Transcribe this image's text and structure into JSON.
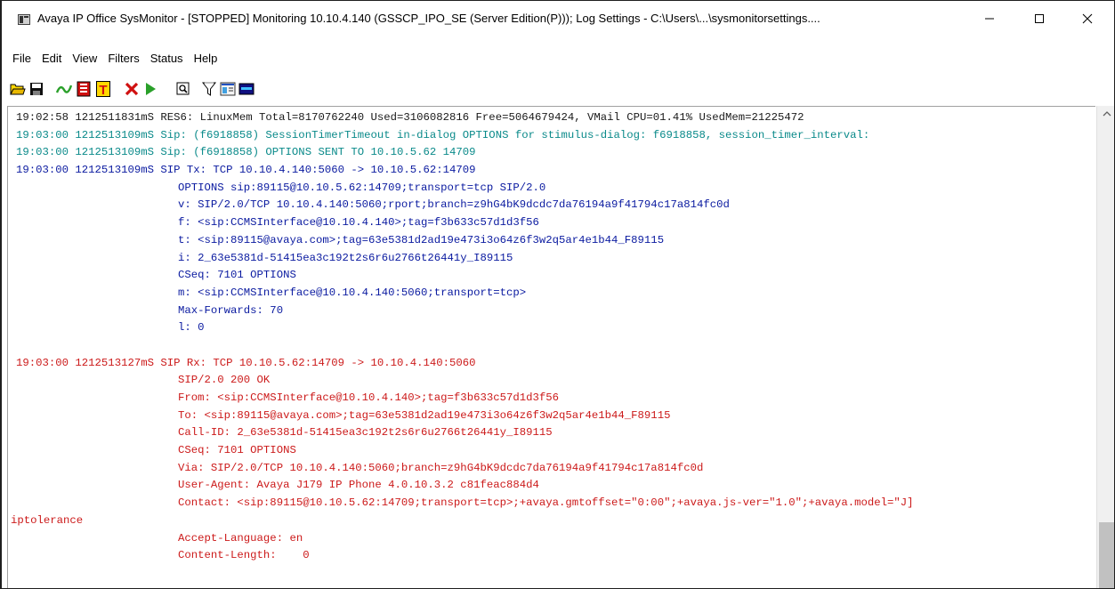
{
  "window": {
    "title": "Avaya IP Office SysMonitor - [STOPPED] Monitoring 10.10.4.140 (GSSCP_IPO_SE (Server Edition(P))); Log Settings - C:\\Users\\...\\sysmonitorsettings....",
    "minimize_glyph": "—",
    "maximize_glyph": "☐",
    "close_glyph": "✕"
  },
  "menu": [
    "File",
    "Edit",
    "View",
    "Filters",
    "Status",
    "Help"
  ],
  "toolbar": {
    "icons": [
      "open-folder-icon",
      "save-icon",
      "trace-wave-icon",
      "clear-log-icon",
      "trace-options-icon",
      "stop-icon",
      "start-icon",
      "find-icon",
      "filter-icon",
      "properties-icon",
      "status-window-icon"
    ],
    "colors": {
      "green": "#2aa02a",
      "red": "#d01010",
      "yellow": "#ffd800",
      "navy": "#101080"
    }
  },
  "log": {
    "colors": {
      "black": "#1a1a1a",
      "teal": "#0a8a8a",
      "blue": "#0a1aa0",
      "red": "#cc1a1a"
    },
    "lines": [
      {
        "text": "19:02:58 1212511831mS RES6: LinuxMem Total=8170762240 Used=3106082816 Free=5064679424, VMail CPU=01.41% UsedMem=21225472",
        "color": "black",
        "indent": false,
        "pad": "p1"
      },
      {
        "text": "19:03:00 1212513109mS Sip: (f6918858) SessionTimerTimeout in-dialog OPTIONS for stimulus-dialog: f6918858, session_timer_interval:",
        "color": "teal",
        "indent": false,
        "pad": "p1"
      },
      {
        "text": "19:03:00 1212513109mS Sip: (f6918858) OPTIONS SENT TO 10.10.5.62 14709",
        "color": "teal",
        "indent": false,
        "pad": "p1"
      },
      {
        "text": "19:03:00 1212513109mS SIP Tx: TCP 10.10.4.140:5060 -> 10.10.5.62:14709",
        "color": "blue",
        "indent": false,
        "pad": "p1"
      },
      {
        "text": "OPTIONS sip:89115@10.10.5.62:14709;transport=tcp SIP/2.0",
        "color": "blue",
        "indent": true
      },
      {
        "text": "v: SIP/2.0/TCP 10.10.4.140:5060;rport;branch=z9hG4bK9dcdc7da76194a9f41794c17a814fc0d",
        "color": "blue",
        "indent": true
      },
      {
        "text": "f: <sip:CCMSInterface@10.10.4.140>;tag=f3b633c57d1d3f56",
        "color": "blue",
        "indent": true
      },
      {
        "text": "t: <sip:89115@avaya.com>;tag=63e5381d2ad19e473i3o64z6f3w2q5ar4e1b44_F89115",
        "color": "blue",
        "indent": true
      },
      {
        "text": "i: 2_63e5381d-51415ea3c192t2s6r6u2766t26441y_I89115",
        "color": "blue",
        "indent": true
      },
      {
        "text": "CSeq: 7101 OPTIONS",
        "color": "blue",
        "indent": true
      },
      {
        "text": "m: <sip:CCMSInterface@10.10.4.140:5060;transport=tcp>",
        "color": "blue",
        "indent": true
      },
      {
        "text": "Max-Forwards: 70",
        "color": "blue",
        "indent": true
      },
      {
        "text": "l: 0",
        "color": "blue",
        "indent": true
      },
      {
        "text": "",
        "color": "blue",
        "indent": false
      },
      {
        "text": "19:03:00 1212513127mS SIP Rx: TCP 10.10.5.62:14709 -> 10.10.4.140:5060",
        "color": "red",
        "indent": false,
        "pad": "p1"
      },
      {
        "text": "SIP/2.0 200 OK",
        "color": "red",
        "indent": true
      },
      {
        "text": "From: <sip:CCMSInterface@10.10.4.140>;tag=f3b633c57d1d3f56",
        "color": "red",
        "indent": true
      },
      {
        "text": "To: <sip:89115@avaya.com>;tag=63e5381d2ad19e473i3o64z6f3w2q5ar4e1b44_F89115",
        "color": "red",
        "indent": true
      },
      {
        "text": "Call-ID: 2_63e5381d-51415ea3c192t2s6r6u2766t26441y_I89115",
        "color": "red",
        "indent": true
      },
      {
        "text": "CSeq: 7101 OPTIONS",
        "color": "red",
        "indent": true
      },
      {
        "text": "Via: SIP/2.0/TCP 10.10.4.140:5060;branch=z9hG4bK9dcdc7da76194a9f41794c17a814fc0d",
        "color": "red",
        "indent": true
      },
      {
        "text": "User-Agent: Avaya J179 IP Phone 4.0.10.3.2 c81feac884d4",
        "color": "red",
        "indent": true
      },
      {
        "text": "Contact: <sip:89115@10.10.5.62:14709;transport=tcp>;+avaya.gmtoffset=\"0:00\";+avaya.js-ver=\"1.0\";+avaya.model=\"J]",
        "color": "red",
        "indent": true
      },
      {
        "text": "iptolerance",
        "color": "red",
        "indent": false,
        "pad": "p0"
      },
      {
        "text": "Accept-Language: en",
        "color": "red",
        "indent": true
      },
      {
        "text": "Content-Length:    0",
        "color": "red",
        "indent": true
      }
    ]
  }
}
